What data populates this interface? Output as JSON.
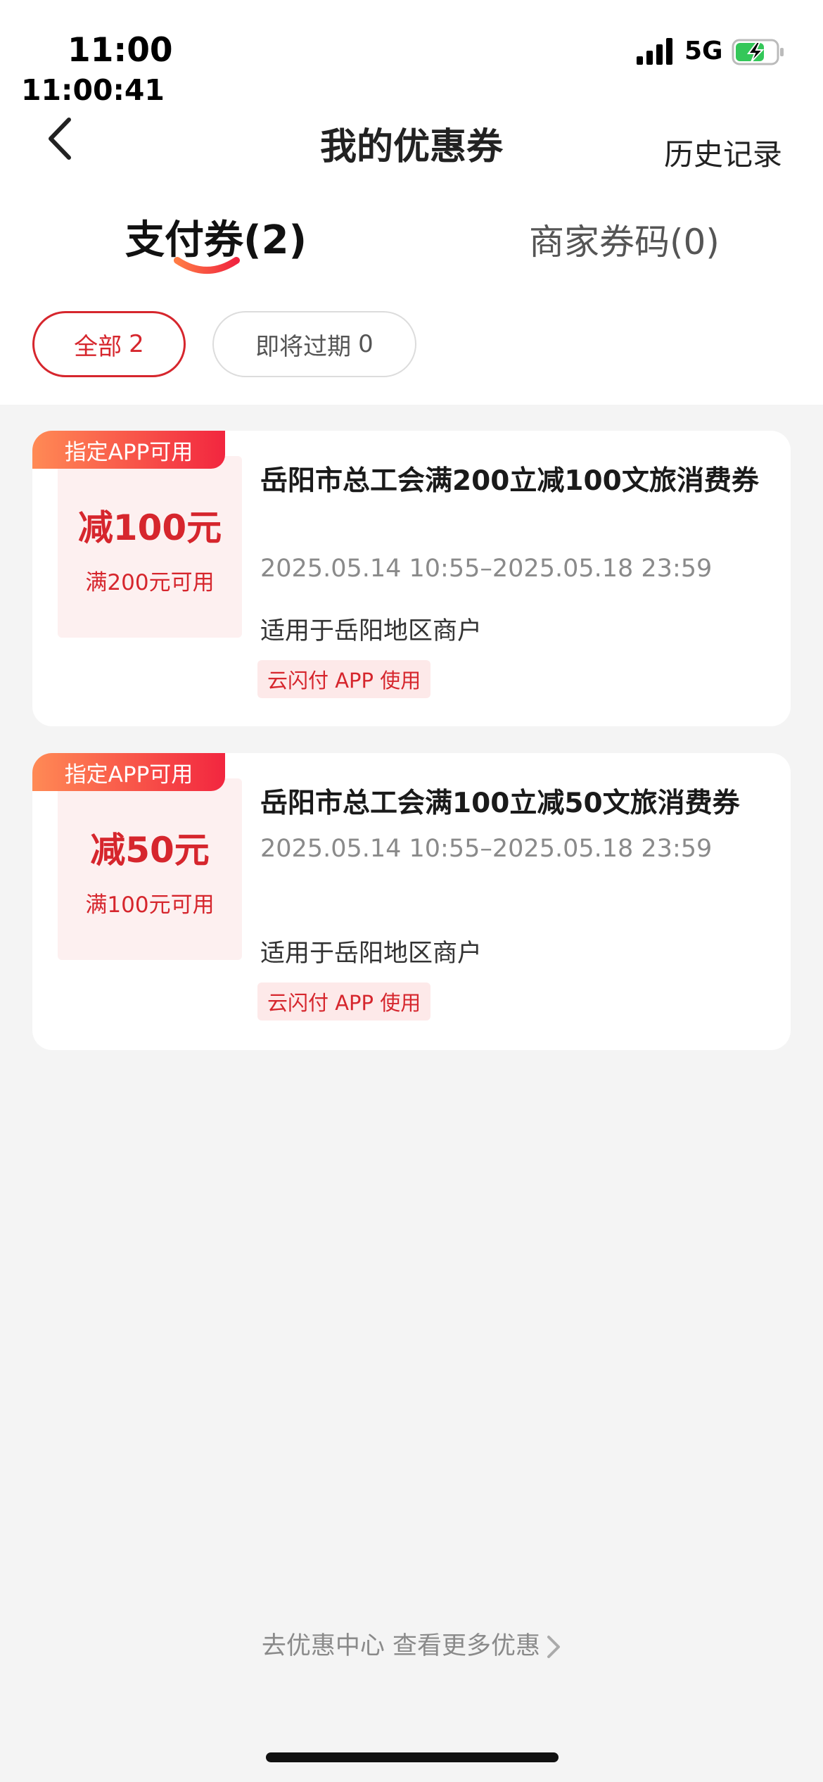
{
  "status_bar": {
    "time": "11:00",
    "clock_overlay": "11:00:41",
    "network": "5G",
    "icons": [
      "signal-icon",
      "battery-charging-icon"
    ]
  },
  "nav": {
    "title": "我的优惠券",
    "history": "历史记录",
    "back_icon": "chevron-left-icon"
  },
  "tabs": [
    {
      "label": "支付券(2)",
      "active": true
    },
    {
      "label": "商家券码(0)",
      "active": false
    }
  ],
  "filters": [
    {
      "label": "全部",
      "count": "2",
      "active": true
    },
    {
      "label": "即将过期",
      "count": "0",
      "active": false
    }
  ],
  "coupons": [
    {
      "tag": "指定APP可用",
      "amount": "减100元",
      "condition": "满200元可用",
      "title": "岳阳市总工会满200立减100文旅消费券",
      "validity": "2025.05.14 10:55–2025.05.18 23:59",
      "scope": "适用于岳阳地区商户",
      "badge": "云闪付 APP 使用"
    },
    {
      "tag": "指定APP可用",
      "amount": "减50元",
      "condition": "满100元可用",
      "title": "岳阳市总工会满100立减50文旅消费券",
      "validity": "2025.05.14 10:55–2025.05.18 23:59",
      "scope": "适用于岳阳地区商户",
      "badge": "云闪付 APP 使用"
    }
  ],
  "footer": {
    "more_link": "去优惠中心 查看更多优惠",
    "chevron_icon": "chevron-right-icon"
  },
  "colors": {
    "accent": "#d6262d",
    "tag_gradient_start": "#ff8a55",
    "tag_gradient_end": "#f2263f",
    "page_bg": "#f4f4f4"
  }
}
